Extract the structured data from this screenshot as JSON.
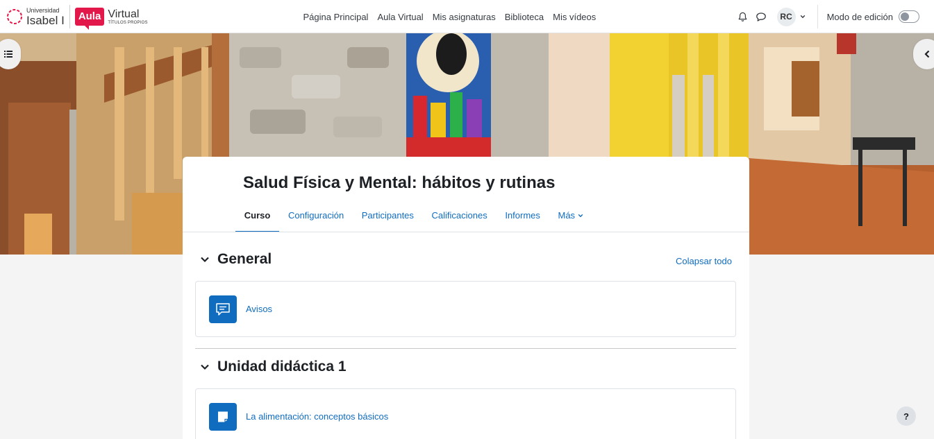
{
  "brand": {
    "university_small": "Universidad",
    "university_big": "Isabel I",
    "aula": "Aula",
    "virtual": "Virtual",
    "subtitle": "TÍTULOS PROPIOS",
    "accent_color": "#e2184a"
  },
  "nav": {
    "items": [
      {
        "label": "Página Principal"
      },
      {
        "label": "Aula Virtual"
      },
      {
        "label": "Mis asignaturas"
      },
      {
        "label": "Biblioteca"
      },
      {
        "label": "Mis vídeos"
      }
    ],
    "user_initials": "RC",
    "edit_mode_label": "Modo de edición",
    "edit_mode_on": false
  },
  "course": {
    "title": "Salud Física y Mental: hábitos y rutinas",
    "tabs": [
      {
        "label": "Curso",
        "active": true
      },
      {
        "label": "Configuración"
      },
      {
        "label": "Participantes"
      },
      {
        "label": "Calificaciones"
      },
      {
        "label": "Informes"
      },
      {
        "label": "Más"
      }
    ],
    "collapse_all": "Colapsar todo",
    "sections": [
      {
        "title": "General",
        "activities": [
          {
            "name": "Avisos",
            "icon": "forum-icon"
          }
        ]
      },
      {
        "title": "Unidad didáctica 1",
        "activities": [
          {
            "name": "La alimentación: conceptos básicos",
            "icon": "page-icon"
          }
        ]
      }
    ]
  },
  "help_label": "?",
  "theme": {
    "link_color": "#0f6cbf",
    "icon_bg": "#0f6cbf"
  }
}
